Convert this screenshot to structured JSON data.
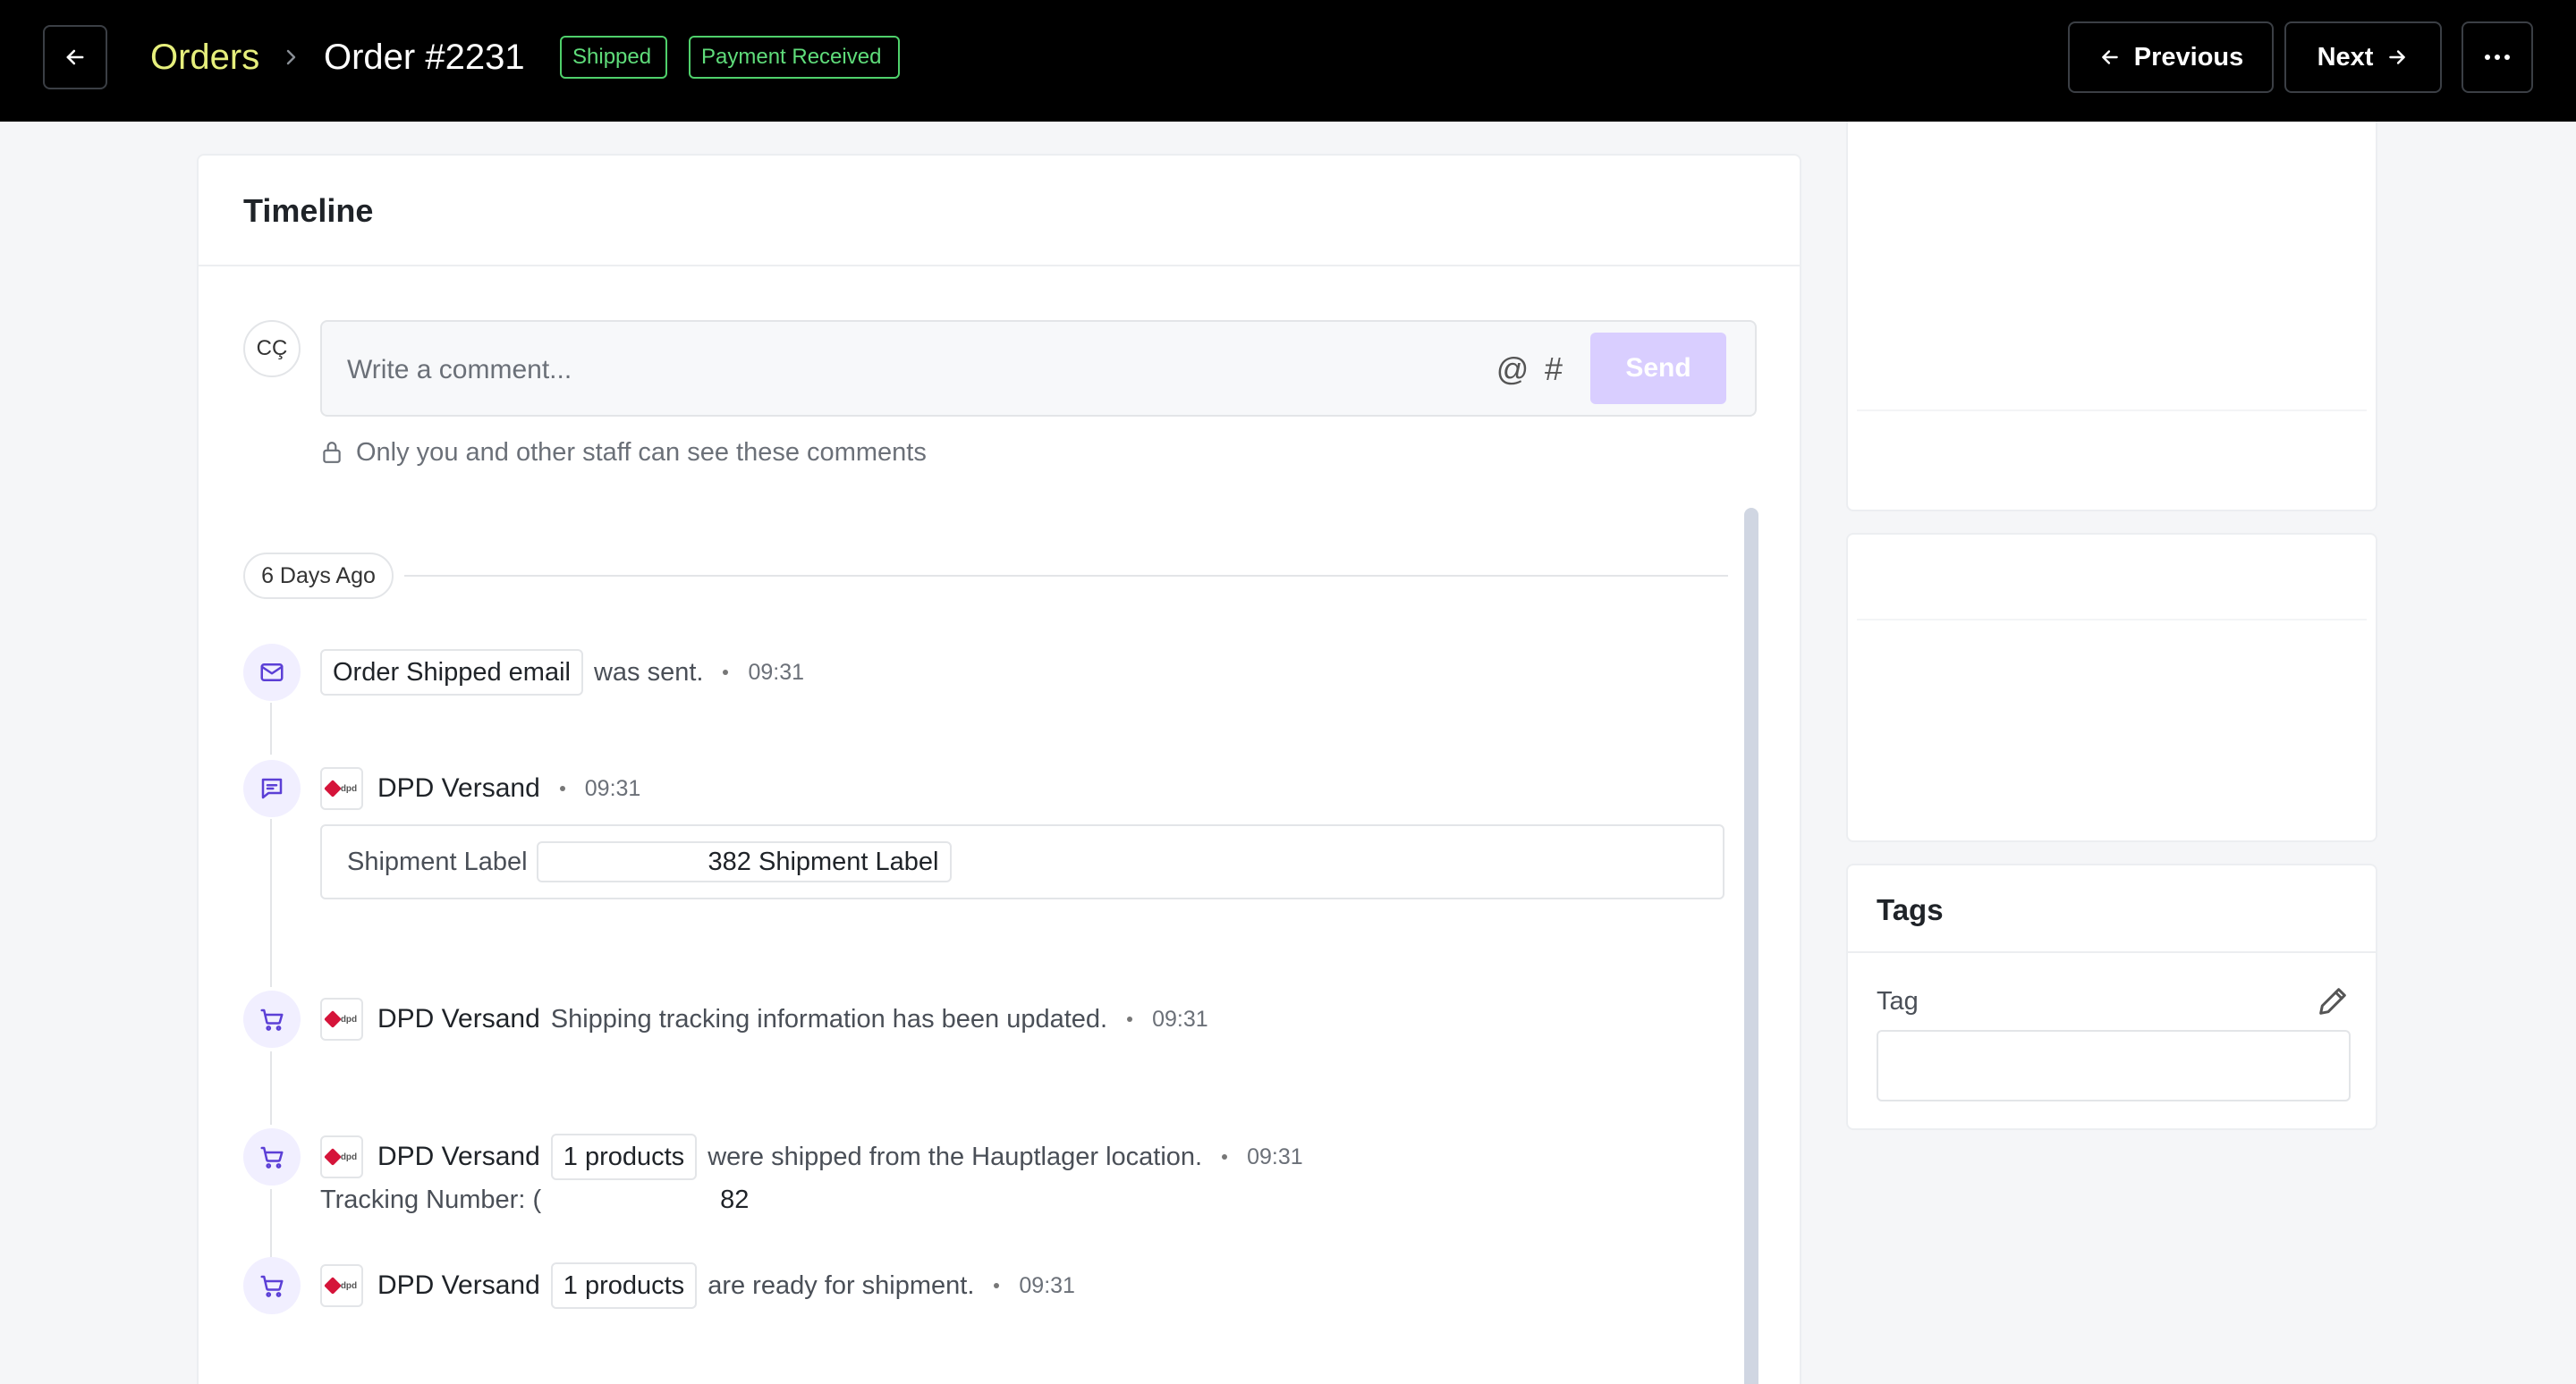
{
  "header": {
    "breadcrumb_root": "Orders",
    "order_title": "Order #2231",
    "badges": {
      "shipped": "Shipped",
      "payment": "Payment Received"
    },
    "previous_label": "Previous",
    "next_label": "Next"
  },
  "timeline": {
    "title": "Timeline",
    "avatar_initials": "CÇ",
    "comment_placeholder": "Write a comment...",
    "send_label": "Send",
    "privacy_note": "Only you and other staff can see these comments",
    "day_label": "6 Days Ago",
    "events": {
      "email": {
        "chip": "Order Shipped email",
        "text": "was sent.",
        "time": "09:31"
      },
      "label": {
        "actor": "DPD Versand",
        "time": "09:31",
        "label_key": "Shipment Label",
        "label_value": "382 Shipment Label"
      },
      "tracking": {
        "actor": "DPD Versand",
        "text": "Shipping tracking information has been updated.",
        "time": "09:31",
        "tracking_label": "Tracking Number: (",
        "tracking_end": "82"
      },
      "shipped": {
        "actor": "DPD Versand",
        "chip": "1 products",
        "text": "were shipped from the Hauptlager location.",
        "time": "09:31"
      },
      "ready": {
        "actor": "DPD Versand",
        "chip": "1 products",
        "text": "are ready for shipment.",
        "time": "09:31"
      }
    },
    "carrier_logo_text": "dpd"
  },
  "tags": {
    "title": "Tags",
    "field_label": "Tag",
    "value": ""
  },
  "colors": {
    "accent": "#e6ef7c",
    "badge_green": "#4fd06b",
    "send_disabled": "#d9ceff",
    "icon_purple": "#5b3fd6",
    "dpd_red": "#d5143a"
  },
  "icons": [
    "arrow-left-icon",
    "chevron-right-icon",
    "ellipsis-icon",
    "arrow-right-icon",
    "at-icon",
    "hash-icon",
    "lock-icon",
    "mail-icon",
    "message-icon",
    "cart-icon",
    "pencil-icon"
  ]
}
